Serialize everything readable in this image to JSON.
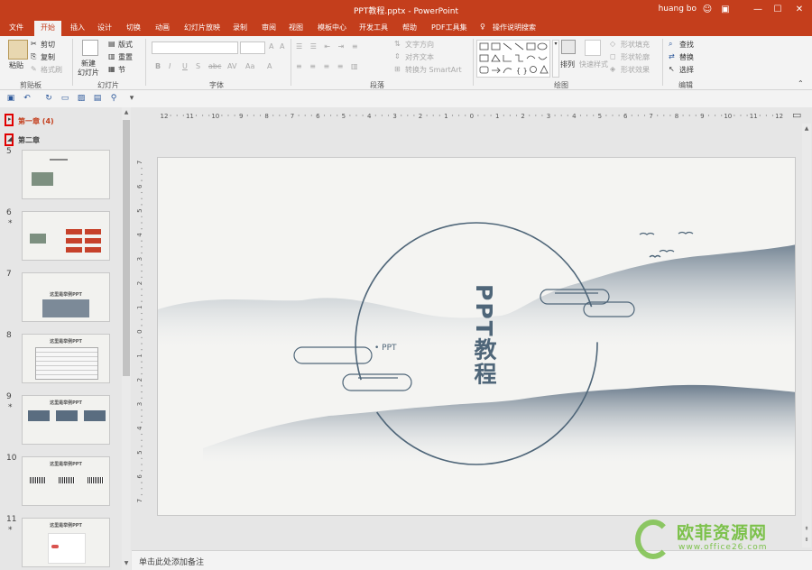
{
  "window": {
    "title": "PPT教程.pptx  -  PowerPoint",
    "user": "huang bo"
  },
  "tabs": [
    "文件",
    "开始",
    "插入",
    "设计",
    "切换",
    "动画",
    "幻灯片放映",
    "录制",
    "审阅",
    "视图",
    "模板中心",
    "开发工具",
    "帮助",
    "PDF工具集",
    "操作说明搜索"
  ],
  "ribbon": {
    "clipboard": {
      "paste": "粘贴",
      "cut": "剪切",
      "copy": "复制",
      "format_painter": "格式刷",
      "group": "剪贴板"
    },
    "slides": {
      "new_slide": "新建",
      "new_slide2": "幻灯片",
      "layout": "版式",
      "reset": "重置",
      "section": "节",
      "group": "幻灯片"
    },
    "font": {
      "group": "字体",
      "bold": "B",
      "italic": "I",
      "underline": "U",
      "shadow": "S",
      "strike": "abc",
      "spacing": "AV",
      "case": "Aa"
    },
    "paragraph": {
      "text_direction": "文字方向",
      "align_text": "对齐文本",
      "smartart": "转换为 SmartArt",
      "group": "段落"
    },
    "drawing": {
      "arrange": "排列",
      "quick_styles": "快速样式",
      "fill": "形状填充",
      "outline": "形状轮廓",
      "effects": "形状效果",
      "group": "绘图"
    },
    "editing": {
      "find": "查找",
      "replace": "替换",
      "select": "选择",
      "group": "编辑"
    }
  },
  "sections": [
    {
      "label": "第一章 (4)"
    },
    {
      "label": "第二章"
    }
  ],
  "thumbnails": [
    {
      "num": "5",
      "star": "",
      "title": "",
      "title2": ""
    },
    {
      "num": "6",
      "star": "*",
      "title": "",
      "title2": ""
    },
    {
      "num": "7",
      "star": "",
      "title": "这里是举例PPT",
      "title2": ""
    },
    {
      "num": "8",
      "star": "",
      "title": "",
      "title2": "这里是举例PPT"
    },
    {
      "num": "9",
      "star": "*",
      "title": "",
      "title2": "这里是举例PPT"
    },
    {
      "num": "10",
      "star": "",
      "title": "",
      "title2": "这里是举例PPT"
    },
    {
      "num": "11",
      "star": "*",
      "title": "",
      "title2": "这里是举例PPT"
    }
  ],
  "ruler": {
    "h": [
      "12",
      "11",
      "10",
      "9",
      "8",
      "7",
      "6",
      "5",
      "4",
      "3",
      "2",
      "1",
      "0",
      "1",
      "2",
      "3",
      "4",
      "5",
      "6",
      "7",
      "8",
      "9",
      "10",
      "11",
      "12"
    ],
    "v": [
      "7",
      "6",
      "5",
      "4",
      "3",
      "2",
      "1",
      "0",
      "1",
      "2",
      "3",
      "4",
      "5",
      "6",
      "7"
    ]
  },
  "slide": {
    "title": "PPT教程",
    "subtitle": "• PPT"
  },
  "notes": {
    "placeholder": "单击此处添加备注"
  },
  "watermark": {
    "brand": "欧菲资源网",
    "url": "www.office26.com"
  },
  "colors": {
    "accent": "#c43e1c",
    "ink": "#4f6679",
    "mountain": "#7f8e9c"
  },
  "icons": [
    "undo-icon",
    "redo-icon",
    "save-icon",
    "search-icon",
    "minimize-icon",
    "maximize-icon",
    "close-icon"
  ]
}
